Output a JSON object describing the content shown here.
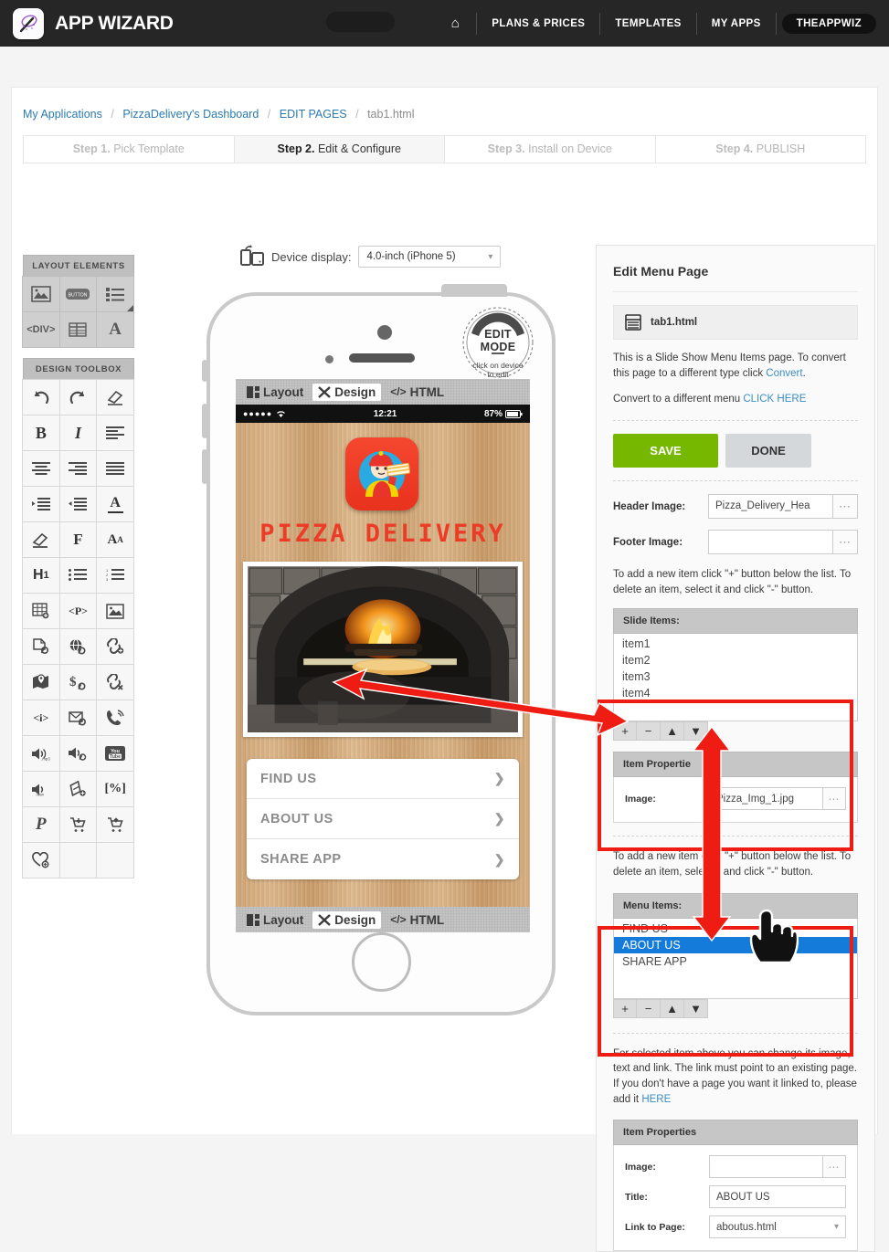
{
  "header": {
    "logo_text": "APP WIZARD",
    "logo_icon": "magic-wand-icon",
    "nav": [
      {
        "label": "⌂",
        "name": "home-icon"
      },
      {
        "label": "PLANS & PRICES",
        "name": "plans-and-prices"
      },
      {
        "label": "TEMPLATES",
        "name": "templates"
      },
      {
        "label": "MY APPS",
        "name": "my-apps"
      }
    ],
    "user": "THEAPPWIZ"
  },
  "breadcrumb": {
    "items": [
      "My Applications",
      "PizzaDelivery's Dashboard",
      "EDIT PAGES"
    ],
    "current": "tab1.html",
    "separator": "/"
  },
  "steps": [
    {
      "num": "Step 1.",
      "label": " Pick Template",
      "active": false
    },
    {
      "num": "Step 2.",
      "label": " Edit & Configure",
      "active": true
    },
    {
      "num": "Step 3.",
      "label": " Install on Device",
      "active": false
    },
    {
      "num": "Step 4.",
      "label": " PUBLISH",
      "active": false
    }
  ],
  "layout_elements": {
    "title": "LAYOUT ELEMENTS",
    "items": [
      {
        "name": "image-element-icon",
        "glyph": "image"
      },
      {
        "name": "button-element-icon",
        "glyph": "button"
      },
      {
        "name": "list-element-icon",
        "glyph": "list"
      },
      {
        "name": "div-element-icon",
        "glyph": "div"
      },
      {
        "name": "table-element-icon",
        "glyph": "table"
      },
      {
        "name": "text-element-icon",
        "glyph": "A"
      }
    ]
  },
  "design_toolbox": {
    "title": "DESIGN TOOLBOX",
    "items": [
      {
        "name": "undo-icon",
        "glyph": "undo"
      },
      {
        "name": "redo-icon",
        "glyph": "redo"
      },
      {
        "name": "erase-format-icon",
        "glyph": "eraser"
      },
      {
        "name": "bold-icon",
        "glyph": "B"
      },
      {
        "name": "italic-icon",
        "glyph": "I"
      },
      {
        "name": "align-left-icon",
        "glyph": "align-left"
      },
      {
        "name": "align-center-icon",
        "glyph": "align-center"
      },
      {
        "name": "align-right-icon",
        "glyph": "align-right"
      },
      {
        "name": "align-justify-icon",
        "glyph": "align-justify"
      },
      {
        "name": "indent-increase-icon",
        "glyph": "indent-in"
      },
      {
        "name": "indent-decrease-icon",
        "glyph": "indent-out"
      },
      {
        "name": "font-color-icon",
        "glyph": "A-underline"
      },
      {
        "name": "highlight-icon",
        "glyph": "pen"
      },
      {
        "name": "font-family-icon",
        "glyph": "F"
      },
      {
        "name": "font-size-icon",
        "glyph": "AA"
      },
      {
        "name": "heading1-icon",
        "glyph": "H1"
      },
      {
        "name": "bullet-list-icon",
        "glyph": "ul"
      },
      {
        "name": "numbered-list-icon",
        "glyph": "ol"
      },
      {
        "name": "insert-table-icon",
        "glyph": "table-plus"
      },
      {
        "name": "paragraph-icon",
        "glyph": "P"
      },
      {
        "name": "insert-image-icon",
        "glyph": "image"
      },
      {
        "name": "page-link-icon",
        "glyph": "page-link"
      },
      {
        "name": "web-link-icon",
        "glyph": "globe-link"
      },
      {
        "name": "add-link-icon",
        "glyph": "link-plus"
      },
      {
        "name": "map-link-icon",
        "glyph": "map-pin"
      },
      {
        "name": "payment-link-icon",
        "glyph": "dollar-link"
      },
      {
        "name": "remove-link-icon",
        "glyph": "link-x"
      },
      {
        "name": "info-icon",
        "glyph": "i"
      },
      {
        "name": "email-link-icon",
        "glyph": "mail-link"
      },
      {
        "name": "phone-link-icon",
        "glyph": "phone-link"
      },
      {
        "name": "audio-mp3-icon",
        "glyph": "mp3"
      },
      {
        "name": "audio-link-icon",
        "glyph": "audio-link"
      },
      {
        "name": "youtube-icon",
        "glyph": "youtube"
      },
      {
        "name": "audio-wav-icon",
        "glyph": "wav"
      },
      {
        "name": "add-slide-icon",
        "glyph": "slide-plus"
      },
      {
        "name": "percent-icon",
        "glyph": "[%]"
      },
      {
        "name": "paypal-icon",
        "glyph": "P"
      },
      {
        "name": "add-to-cart-icon",
        "glyph": "cart-down"
      },
      {
        "name": "cart-upload-icon",
        "glyph": "cart-up"
      },
      {
        "name": "add-favorite-icon",
        "glyph": "heart-plus"
      }
    ]
  },
  "device": {
    "label": "Device display:",
    "selected": "4.0-inch (iPhone 5)",
    "toggle_icon": "device-rotate-icon",
    "edit_badge": {
      "line1": "EDIT",
      "line2": "MODE",
      "line3": "click on device",
      "line4": "to edit"
    },
    "mode_tabs": [
      {
        "label": "Layout",
        "icon": "layout-icon",
        "selected": false
      },
      {
        "label": "Design",
        "icon": "design-cross-icon",
        "selected": true
      },
      {
        "label": "HTML",
        "icon": "code-icon",
        "selected": false
      }
    ],
    "status": {
      "signal": "●●●●●",
      "wifi": "wifi-icon",
      "time": "12:21",
      "battery": "87%"
    },
    "app": {
      "title": "PIZZA DELIVERY",
      "icon": "pizza-delivery-app-icon",
      "photo": "pizza-oven-photo",
      "menu": [
        {
          "label": "FIND US"
        },
        {
          "label": "ABOUT US"
        },
        {
          "label": "SHARE APP"
        }
      ]
    },
    "bottom_tabs": [
      {
        "label": "Layout",
        "icon": "layout-icon",
        "selected": false
      },
      {
        "label": "Design",
        "icon": "design-cross-icon",
        "selected": true
      },
      {
        "label": "HTML",
        "icon": "code-icon",
        "selected": false
      }
    ]
  },
  "panel": {
    "title": "Edit Menu Page",
    "file": {
      "name": "tab1.html",
      "icon": "page-icon"
    },
    "desc_1a": "This is a Slide Show Menu Items page. To convert this page to a different type click ",
    "desc_1_link": "Convert",
    "desc_1b": ".",
    "desc_2": "Convert to a different menu ",
    "desc_2_link": "CLICK HERE",
    "save_label": "SAVE",
    "done_label": "DONE",
    "header_image_label": "Header Image:",
    "header_image_value": "Pizza_Delivery_Hea",
    "footer_image_label": "Footer Image:",
    "footer_image_value": "",
    "hint_1": "To add a new item click \"+\" button below the list. To delete an item, select it and click \"-\" button.",
    "slide_items": {
      "title": "Slide Items:",
      "items": [
        "item1",
        "item2",
        "item3",
        "item4"
      ],
      "buttons": [
        "+",
        "−",
        "▲",
        "▼"
      ]
    },
    "slide_item_properties": {
      "title": "Item Propertie",
      "image_label": "Image:",
      "image_value": "Pizza_Img_1.jpg"
    },
    "hint_2": "To add a new item click \"+\" button below the list. To delete an item, select it and click \"-\" button.",
    "menu_items": {
      "title": "Menu Items:",
      "items": [
        "FIND US",
        "ABOUT US",
        "SHARE APP"
      ],
      "selected_index": 1,
      "buttons": [
        "+",
        "−",
        "▲",
        "▼"
      ]
    },
    "hint_3a": "For selected item above you can change its image, text and link. The link must point to an existing page. If you don't have a page you want it linked to, please add it ",
    "hint_3_link": "HERE",
    "item_properties": {
      "title": "Item Properties",
      "image_label": "Image:",
      "image_value": "",
      "title_label": "Title:",
      "title_value": "ABOUT US",
      "link_label": "Link to Page:",
      "link_value": "aboutus.html"
    }
  },
  "annotations": {
    "highlight_color": "#ee1c12",
    "selection_color": "#147bdb",
    "accent_green": "#76b800",
    "cursor": "pointing-hand-cursor"
  }
}
